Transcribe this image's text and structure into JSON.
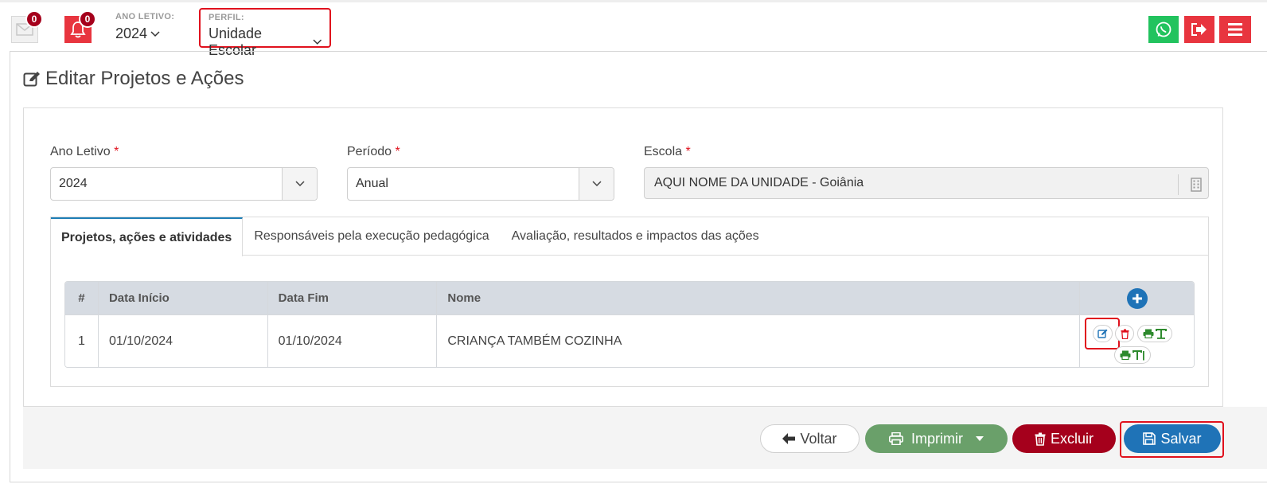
{
  "topbar": {
    "mail_badge": "0",
    "bell_badge": "0",
    "ano_letivo_label": "ANO LETIVO:",
    "ano_letivo_value": "2024",
    "perfil_label": "PERFIL:",
    "perfil_value": "Unidade Escolar"
  },
  "page": {
    "title": "Editar Projetos e Ações"
  },
  "form": {
    "ano_letivo": {
      "label": "Ano Letivo",
      "required": "*",
      "value": "2024"
    },
    "periodo": {
      "label": "Período",
      "required": "*",
      "value": "Anual"
    },
    "escola": {
      "label": "Escola",
      "required": "*",
      "value": "AQUI NOME DA UNIDADE - Goiânia"
    }
  },
  "tabs": [
    {
      "label": "Projetos, ações e atividades",
      "active": true
    },
    {
      "label": "Responsáveis pela execução pedagógica",
      "active": false
    },
    {
      "label": "Avaliação, resultados e impactos das ações",
      "active": false
    }
  ],
  "table": {
    "headers": [
      "#",
      "Data Início",
      "Data Fim",
      "Nome"
    ],
    "rows": [
      {
        "num": "1",
        "inicio": "01/10/2024",
        "fim": "01/10/2024",
        "nome": "CRIANÇA TAMBÉM COZINHA"
      }
    ]
  },
  "footer": {
    "voltar": "Voltar",
    "imprimir": "Imprimir",
    "excluir": "Excluir",
    "salvar": "Salvar"
  },
  "colors": {
    "red": "#e8353f",
    "dark_red": "#a5001c",
    "blue": "#1f73b7",
    "green": "#6aa06a",
    "whatsapp": "#22c35e"
  }
}
